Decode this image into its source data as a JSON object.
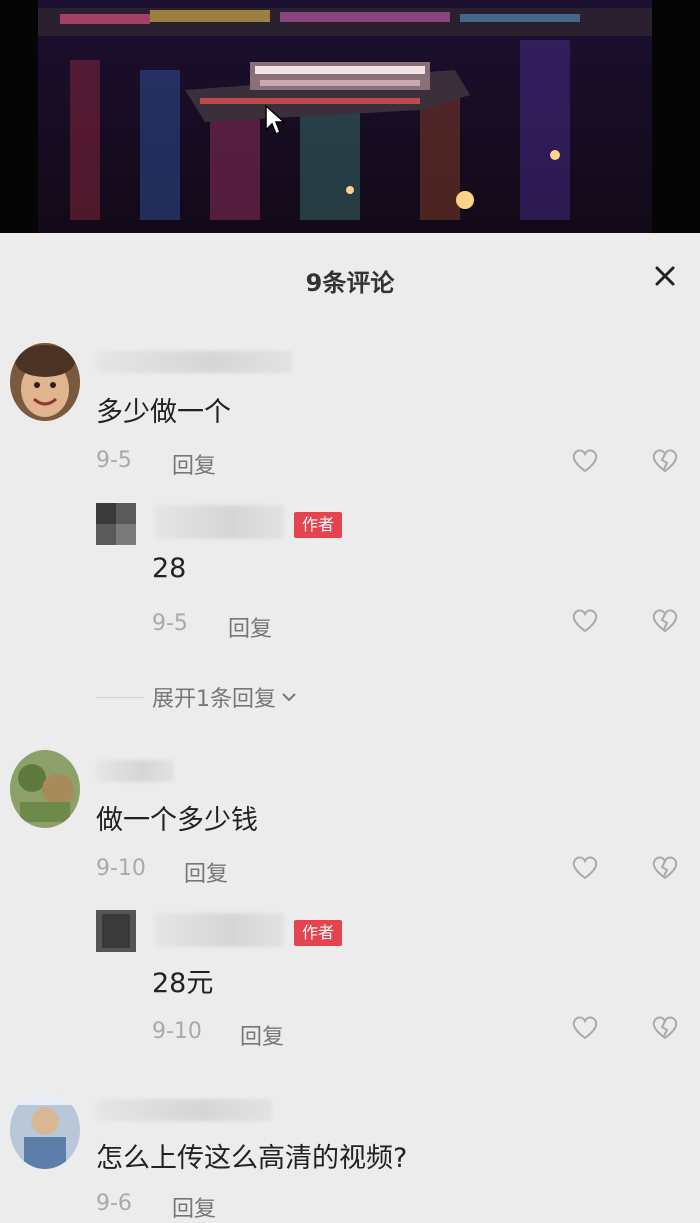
{
  "panel": {
    "title": "9条评论"
  },
  "comments": [
    {
      "text": "多少做一个",
      "date": "9-5",
      "reply_label": "回复",
      "reply": {
        "badge": "作者",
        "text": "28",
        "date": "9-5",
        "reply_label": "回复"
      },
      "expand_label": "展开1条回复"
    },
    {
      "text": "做一个多少钱",
      "date": "9-10",
      "reply_label": "回复",
      "reply": {
        "badge": "作者",
        "text": "28元",
        "date": "9-10",
        "reply_label": "回复"
      }
    },
    {
      "text": "怎么上传这么高清的视频?",
      "date": "9-6",
      "reply_label": "回复"
    }
  ],
  "colors": {
    "accent": "#e3444f",
    "background": "#ececec",
    "top_line": "#2d5bd8"
  },
  "icons": {
    "close": "close-icon",
    "like": "heart-icon",
    "dislike": "broken-heart-icon",
    "cursor": "cursor-arrow-icon"
  }
}
